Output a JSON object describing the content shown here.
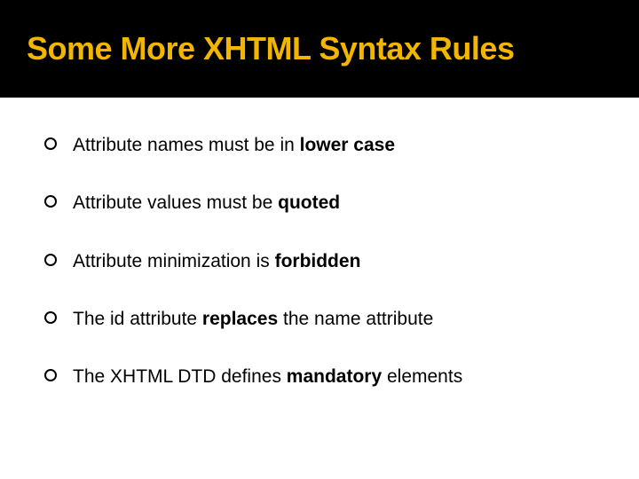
{
  "title": "Some More XHTML Syntax Rules",
  "bullets": [
    {
      "pre": "Attribute names must be in ",
      "bold": "lower case",
      "post": ""
    },
    {
      "pre": "Attribute values must be ",
      "bold": "quoted",
      "post": ""
    },
    {
      "pre": "Attribute minimization is ",
      "bold": "forbidden",
      "post": ""
    },
    {
      "pre": "The id attribute ",
      "bold": "replaces",
      "post": " the name attribute"
    },
    {
      "pre": "The XHTML DTD defines ",
      "bold": "mandatory",
      "post": " elements"
    }
  ]
}
